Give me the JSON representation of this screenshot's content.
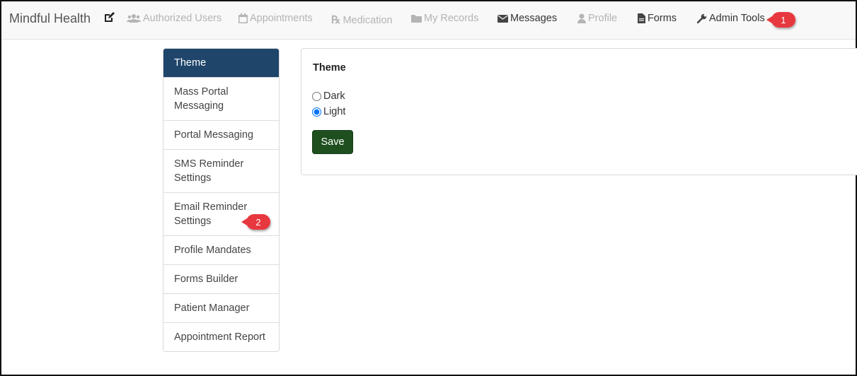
{
  "brand": "Mindful Health",
  "nav": {
    "authorized_users": "Authorized Users",
    "appointments": "Appointments",
    "medication_symbol": "℞",
    "medication": "Medication",
    "my_records": "My Records",
    "messages": "Messages",
    "profile": "Profile",
    "forms": "Forms",
    "admin_tools": "Admin Tools"
  },
  "callouts": [
    "1",
    "2"
  ],
  "sidebar": {
    "items": [
      {
        "label": "Theme"
      },
      {
        "label": "Mass Portal Messaging"
      },
      {
        "label": "Portal Messaging"
      },
      {
        "label": "SMS Reminder Settings"
      },
      {
        "label": "Email Reminder Settings"
      },
      {
        "label": "Profile Mandates"
      },
      {
        "label": "Forms Builder"
      },
      {
        "label": "Patient Manager"
      },
      {
        "label": "Appointment Report"
      }
    ]
  },
  "panel": {
    "title": "Theme",
    "options": [
      "Dark",
      "Light"
    ],
    "selected": "Light",
    "save_label": "Save"
  },
  "colors": {
    "active_sidebar": "#1f456b",
    "save_button": "#1f4f1f",
    "callout": "#e8383f"
  }
}
